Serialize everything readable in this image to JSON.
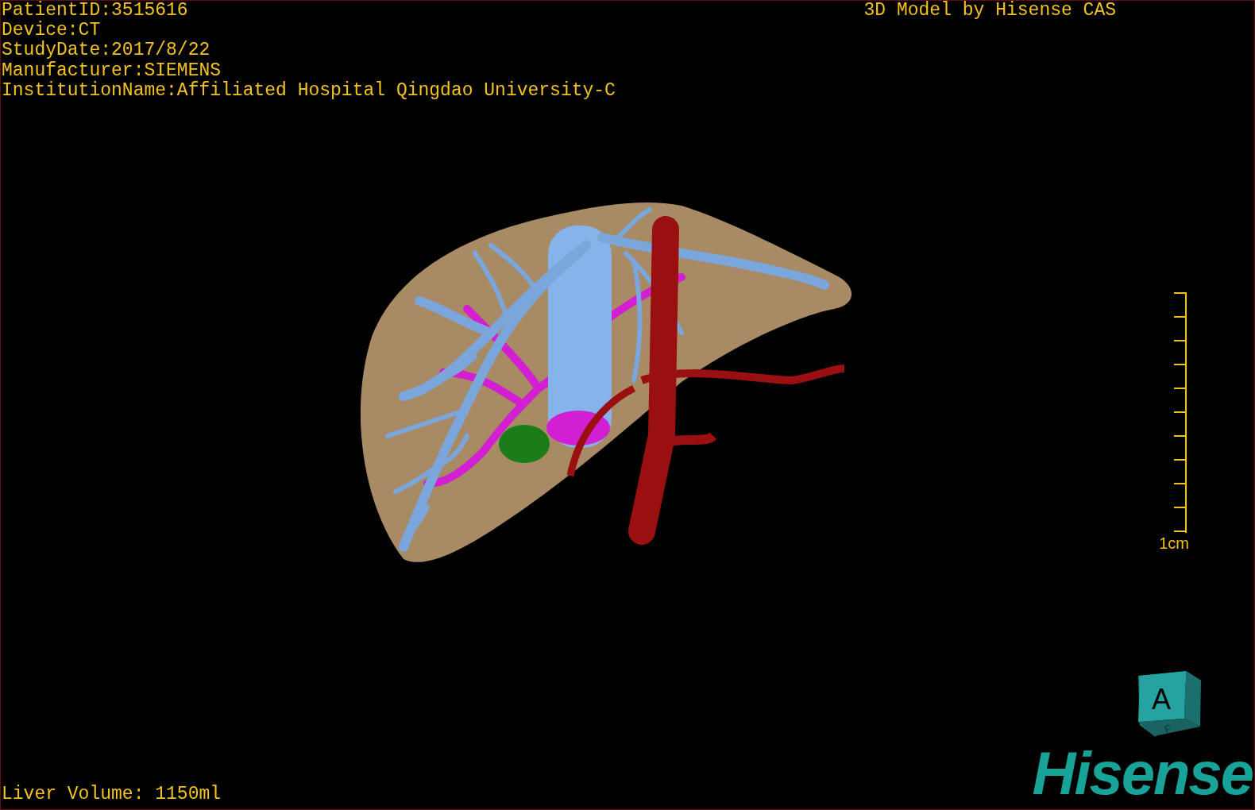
{
  "overlay": {
    "info_lines": [
      "PatientID:3515616",
      "Device:CT",
      "StudyDate:2017/8/22",
      "Manufacturer:SIEMENS",
      "InstitutionName:Affiliated Hospital Qingdao University-C"
    ],
    "credit": "3D Model by Hisense CAS",
    "liver_volume": "Liver Volume: 1150ml"
  },
  "scale_bar": {
    "label": "1cm"
  },
  "orientation_cube": {
    "front": "A",
    "bottom": "F"
  },
  "logo": "Hisense"
}
